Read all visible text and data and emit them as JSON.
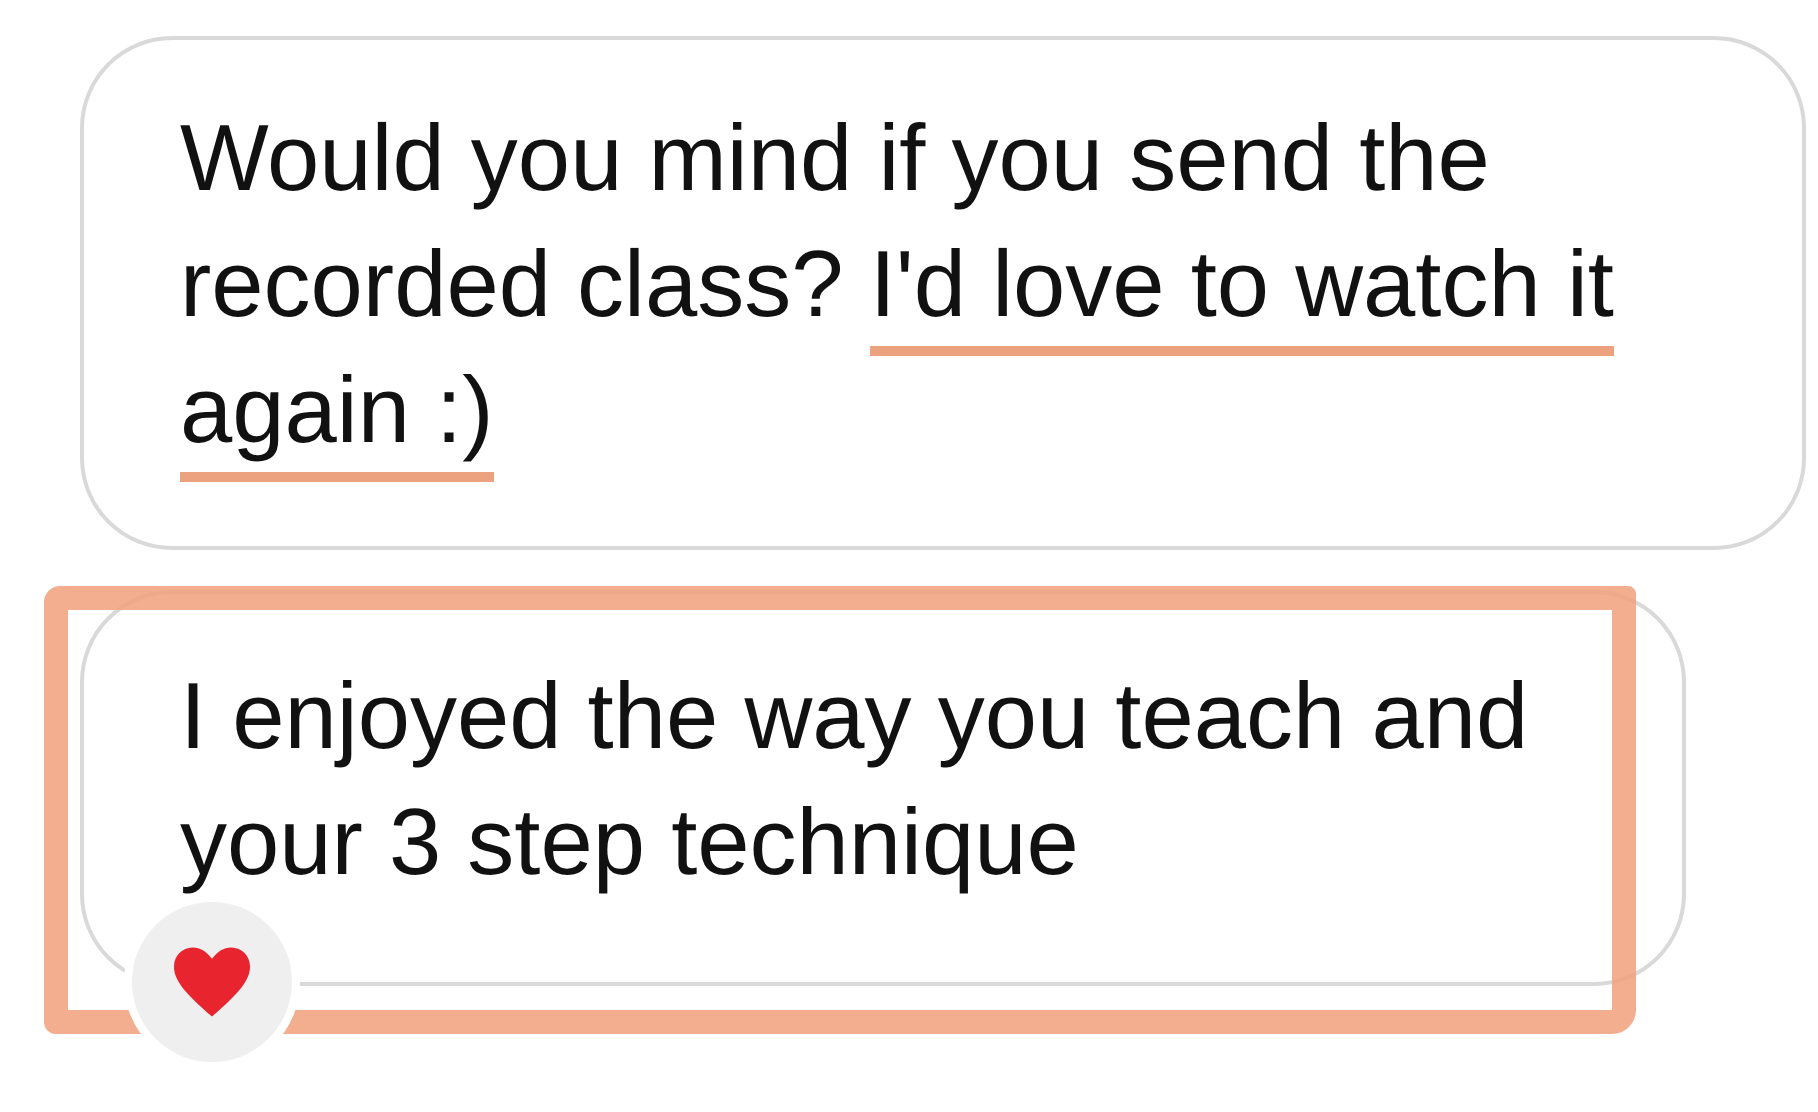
{
  "messages": [
    {
      "lines": [
        [
          {
            "text": "Would you mind if you send the",
            "underlined": false
          }
        ],
        [
          {
            "text": "recorded class? ",
            "underlined": false
          },
          {
            "text": "I'd love to watch it",
            "underlined": true
          }
        ],
        [
          {
            "text": "again :)",
            "underlined": true
          }
        ]
      ],
      "boxed": false,
      "reacted": false
    },
    {
      "lines": [
        [
          {
            "text": "I enjoyed the way you teach and",
            "underlined": false
          }
        ],
        [
          {
            "text": "your 3 step technique",
            "underlined": false
          }
        ]
      ],
      "boxed": true,
      "reacted": true
    }
  ]
}
